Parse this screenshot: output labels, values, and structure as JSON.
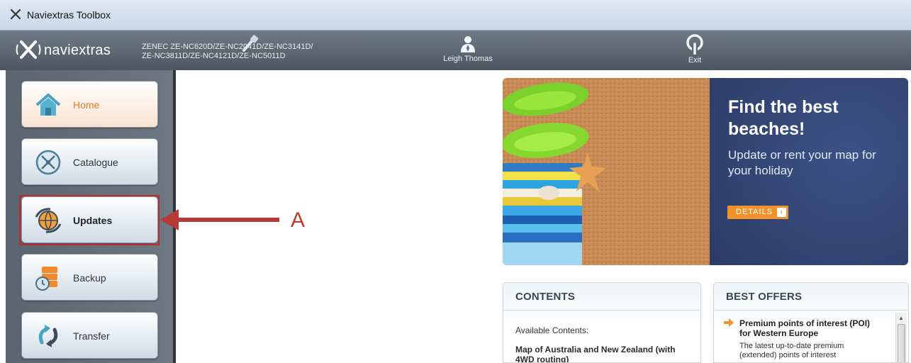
{
  "window": {
    "title": "Naviextras Toolbox"
  },
  "header": {
    "logo_text": "naviextras",
    "device_line1": "ZENEC ZE-NC620D/ZE-NC2041D/ZE-NC3141D/",
    "device_line2": "ZE-NC3811D/ZE-NC4121D/ZE-NC5011D",
    "user_label": "Leigh Thomas",
    "exit_label": "Exit"
  },
  "sidebar": {
    "items": [
      {
        "label": "Home",
        "icon": "home-icon"
      },
      {
        "label": "Catalogue",
        "icon": "compass-icon"
      },
      {
        "label": "Updates",
        "icon": "globe-sync-icon"
      },
      {
        "label": "Backup",
        "icon": "backup-icon"
      },
      {
        "label": "Transfer",
        "icon": "transfer-icon"
      }
    ]
  },
  "annotation": {
    "label": "A",
    "color": "#c0392b"
  },
  "banner": {
    "headline": "Find the best beaches!",
    "subtext": "Update or rent your map for your holiday",
    "button_label": "DETAILS"
  },
  "contents_panel": {
    "title": "CONTENTS",
    "available_label": "Available Contents:",
    "item": "Map of Australia and New Zealand (with 4WD routing)"
  },
  "offers_panel": {
    "title": "BEST OFFERS",
    "offer_title": "Premium points of interest (POI) for Western Europe",
    "offer_desc": "The latest up-to-date premium (extended) points of interest"
  },
  "colors": {
    "accent": "#f2922c",
    "promo_bg": "#2f4272",
    "header_bg": "#5b6670"
  }
}
